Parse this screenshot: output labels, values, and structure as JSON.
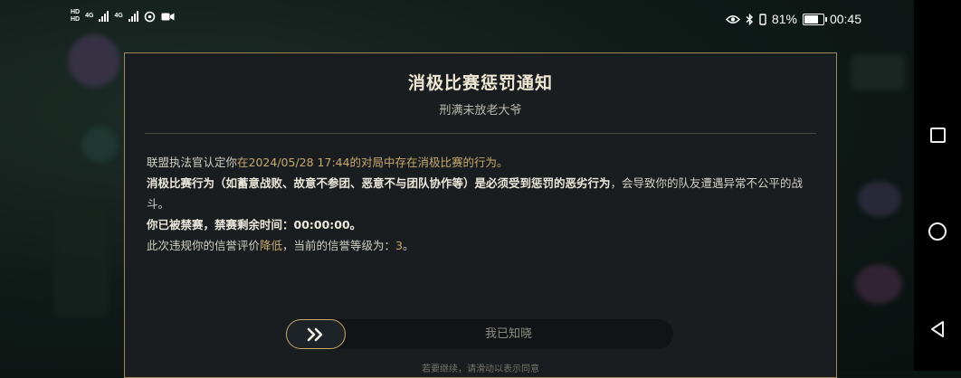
{
  "status_bar": {
    "hd1": "HD",
    "hd2": "HD",
    "net1": "4G",
    "net2": "4G",
    "battery_text": "81%",
    "battery_level": 0.81,
    "time": "00:45"
  },
  "dialog": {
    "title": "消极比赛惩罚通知",
    "subtitle": "刑满未放老大爷",
    "line1_prefix": "联盟执法官认定你",
    "line1_highlight": "在2024/05/28 17:44的对局中存在消极比赛的行为。",
    "line2_bold": "消极比赛行为（如蓄意战败、故意不参团、恶意不与团队协作等）是必须受到惩罚的恶劣行为",
    "line2_rest": "，会导致你的队友遭遇异常不公平的战斗。",
    "line3": "你已被禁赛，禁赛剩余时间：00:00:00。",
    "line4_prefix": "此次违规你的信誉评价",
    "line4_highlight": "降低",
    "line4_mid": "，当前的信誉等级为：",
    "line4_level": "3",
    "line4_end": "。",
    "slider_label": "我已知晓",
    "hint": "若要继续，请滑动以表示同意"
  },
  "colors": {
    "accent_gold": "#c8aa6e",
    "dialog_bg": "#191d1f"
  }
}
